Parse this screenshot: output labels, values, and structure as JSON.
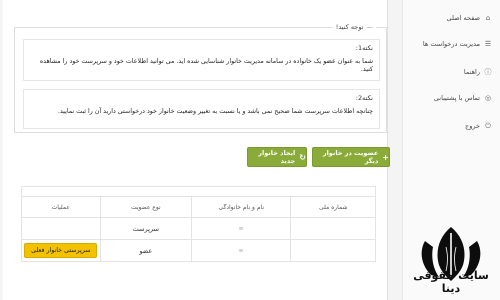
{
  "sidebar": {
    "items": [
      {
        "label": "صفحه اصلی",
        "icon": "home-icon"
      },
      {
        "label": "مدیریت درخواست ها",
        "icon": "list-icon"
      },
      {
        "label": "راهنما",
        "icon": "info-icon"
      },
      {
        "label": "تماس با پشتیبانی",
        "icon": "support-icon"
      },
      {
        "label": "خروج",
        "icon": "logout-icon"
      }
    ]
  },
  "notice": {
    "legend": "توجه کنید!",
    "notes": [
      {
        "title": "نکته1:",
        "text": "شما به عنوان عضو یک خانواده در سامانه مدیریت خانوار شناسایی شده اید. می توانید اطلاعات خود و سرپرست خود را مشاهده کنید."
      },
      {
        "title": "نکته2:",
        "text": "چنانچه اطلاعات سرپرست شما صحیح نمی باشد و یا نسبت به تغییر وضعیت خانوار خود درخواستی دارید آن را ثبت نمایید."
      }
    ]
  },
  "actions": {
    "join_other": "عضویت در خانوار دیگر",
    "create_new": "ایجاد خانوار جدید"
  },
  "table": {
    "headers": [
      "شماره ملی",
      "نام و نام خانوادگی",
      "نوع عضویت",
      "عملیات"
    ],
    "rows": [
      {
        "membership": "سرپرست",
        "action": ""
      },
      {
        "membership": "عضو",
        "action": "سرپرستی خانوار فعلی"
      }
    ]
  },
  "logo": {
    "text": "سایت حقوقی دینا"
  },
  "colors": {
    "accent_green": "#8aaa3a",
    "action_yellow": "#f2c200"
  }
}
